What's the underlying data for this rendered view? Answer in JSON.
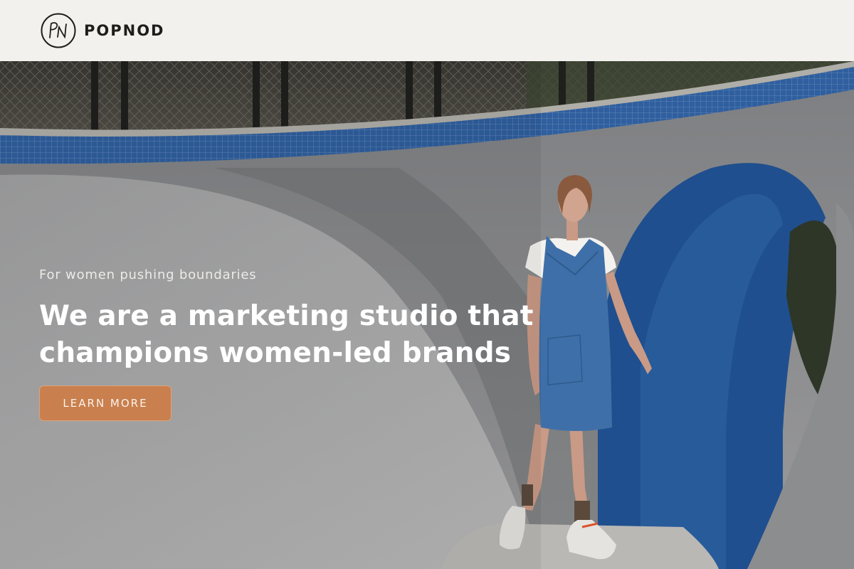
{
  "header": {
    "logo_icon": "pn-monogram-icon",
    "logo_text": "PN",
    "brand_name": "POPNOD"
  },
  "hero": {
    "image": "woman-in-denim-dress-standing-in-concrete-skate-bowl",
    "eyebrow": "For women pushing boundaries",
    "headline_line1": "We are a marketing studio that",
    "headline_line2": "champions women-led brands",
    "cta_label": "LEARN MORE"
  },
  "colors": {
    "header_bg": "#f2f1ee",
    "brand_text": "#1d1d1b",
    "cta_bg": "#c9804e",
    "headline": "#ffffff",
    "concrete": "#8e8f91",
    "tile_blue": "#2f5f9e"
  }
}
